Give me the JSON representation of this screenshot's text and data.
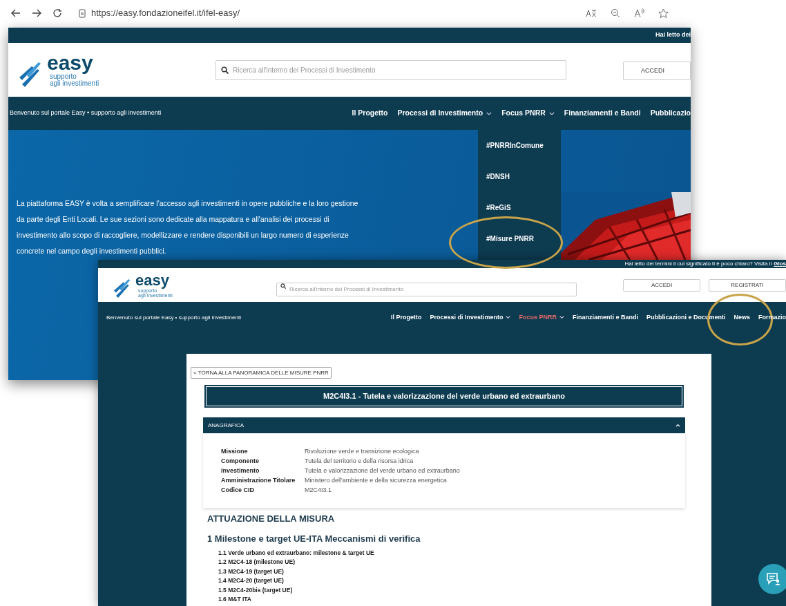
{
  "browser": {
    "url": "https://easy.fondazioneifel.it/ifel-easy/"
  },
  "screenshot_1": {
    "notice": "Hai letto dei",
    "logo": {
      "name": "easy",
      "tagline_1": "supporto",
      "tagline_2": "agli investimenti"
    },
    "search": {
      "placeholder": "Ricerca all'interno dei Processi di Investimento"
    },
    "buttons": [
      "ACCEDI"
    ],
    "welcome": "Benvenuto sul portale Easy • supporto agli investimenti",
    "nav": [
      {
        "label": "Il Progetto",
        "kind": "link"
      },
      {
        "label": "Processi di Investimento",
        "kind": "menu"
      },
      {
        "label": "Focus PNRR",
        "kind": "menu"
      },
      {
        "label": "Finanziamenti e Bandi",
        "kind": "link"
      },
      {
        "label": "Pubblicazio",
        "kind": "link"
      }
    ],
    "dropdown": [
      {
        "label": "#PNRRInComune",
        "highlighted": false
      },
      {
        "label": "#DNSH",
        "highlighted": false
      },
      {
        "label": "#ReGiS",
        "highlighted": false
      },
      {
        "label": "#Misure PNRR",
        "highlighted": true
      }
    ],
    "intro": "La piattaforma EASY è volta a semplificare l'accesso agli investimenti in opere pubbliche e la loro gestione da parte degli Enti Locali. Le sue sezioni sono dedicate alla mappatura e all'analisi dei processi di investimento allo scopo di raccogliere, modellizzare e rendere disponibili un largo numero di esperienze concrete nel campo degli investimenti pubblici."
  },
  "screenshot_2": {
    "notice": "Hai letto dei termini il cui significato ti è poco chiaro? Visita il",
    "notice_link": "Glos",
    "logo": {
      "name": "easy",
      "tagline_1": "supporto",
      "tagline_2": "agli investimenti"
    },
    "search": {
      "placeholder": "Ricerca all'interno dei Processi di Investimento"
    },
    "buttons": [
      "ACCEDI",
      "REGISTRATI"
    ],
    "welcome": "Benvenuto sul portale Easy • supporto agli investimenti",
    "nav": [
      {
        "label": "Il Progetto",
        "kind": "link",
        "selected": false,
        "highlighted": false
      },
      {
        "label": "Processi di Investimento",
        "kind": "menu",
        "selected": false,
        "highlighted": false
      },
      {
        "label": "Focus PNRR",
        "kind": "menu",
        "selected": true,
        "highlighted": false
      },
      {
        "label": "Finanziamenti e Bandi",
        "kind": "link",
        "selected": false,
        "highlighted": false
      },
      {
        "label": "Pubblicazioni e Documenti",
        "kind": "link",
        "selected": false,
        "highlighted": false
      },
      {
        "label": "News",
        "kind": "link",
        "selected": false,
        "highlighted": true
      },
      {
        "label": "Formazio",
        "kind": "link",
        "selected": false,
        "highlighted": false
      }
    ],
    "back_button": "< TORNA ALLA PANORAMICA DELLE MISURE PNRR",
    "title": "M2C4I3.1 - Tutela e valorizzazione del verde urbano ed extraurbano",
    "anagrafica": {
      "title": "ANAGRAFICA",
      "expanded": true,
      "rows": [
        {
          "label": "Missione",
          "value": "Rivoluzione verde e transizione ecologica"
        },
        {
          "label": "Componente",
          "value": "Tutela del territorio e della risorsa idrica"
        },
        {
          "label": "Investimento",
          "value": "Tutela e valorizzazione del verde urbano ed extraurbano"
        },
        {
          "label": "Amministrazione Titolare",
          "value": "Ministero dell'ambiente e della sicurezza energetica"
        },
        {
          "label": "Codice CID",
          "value": "M2C4I3.1"
        }
      ]
    },
    "section_title": "ATTUAZIONE DELLA MISURA",
    "outline": [
      {
        "label": "1 Milestone e target UE-ITA Meccanismi di verifica",
        "children": [
          {
            "label": "1.1 Verde urbano ed extraurbano: milestone & target UE"
          },
          {
            "label": "1.2 M2C4-18 (milestone UE)"
          },
          {
            "label": "1.3 M2C4-19 (target UE)"
          },
          {
            "label": "1.4 M2C4-20 (target UE)"
          },
          {
            "label": "1.5 M2C4-20bis (target UE)"
          },
          {
            "label": "1.6 M&T ITA"
          }
        ]
      }
    ]
  }
}
